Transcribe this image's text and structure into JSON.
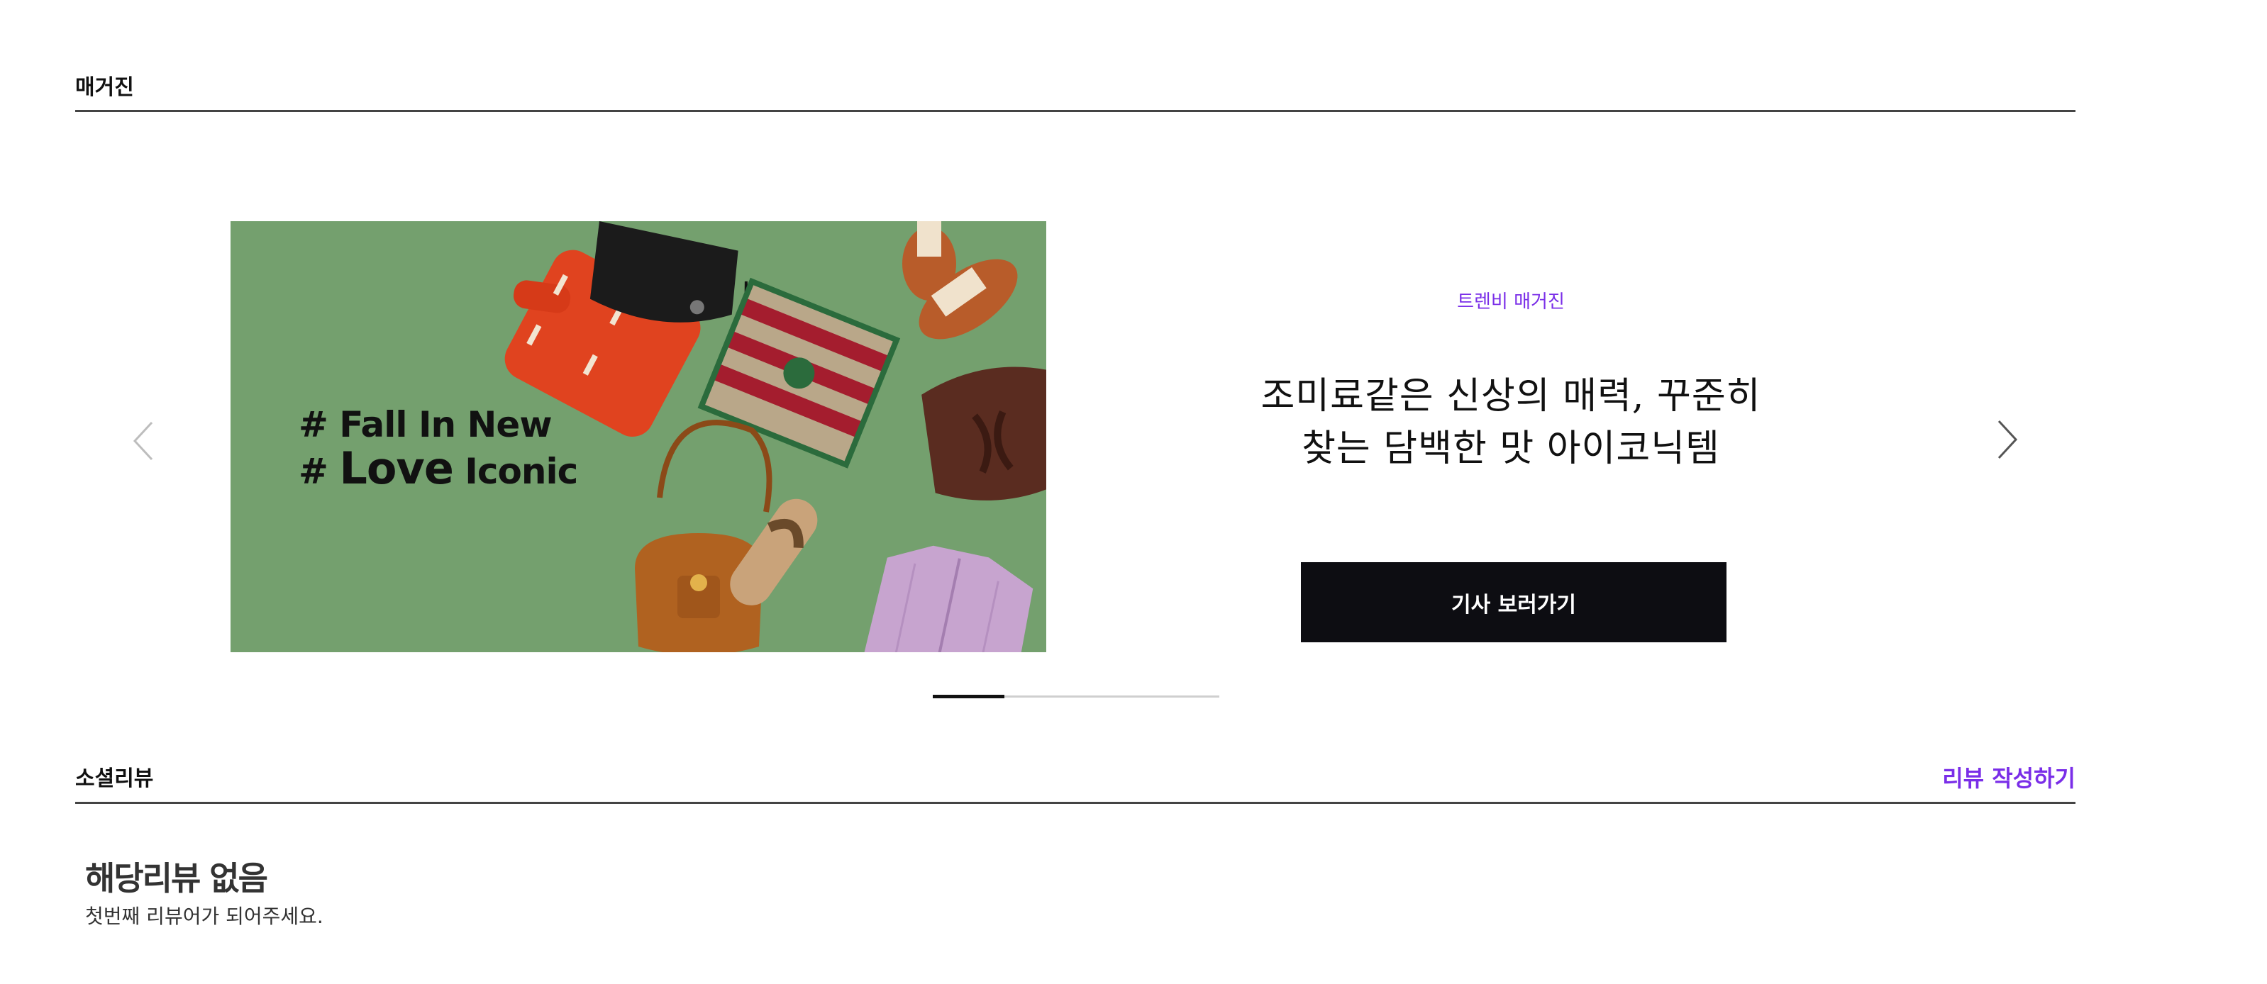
{
  "magazine": {
    "section_title": "매거진",
    "banner": {
      "line1": "# Fall In New",
      "line2_prefix": "# ",
      "line2_big": "Love",
      "line2_rest": " Iconic",
      "background_color": "#74a06e"
    },
    "article": {
      "tag": "트렌비 매거진",
      "title_line1": "조미료같은 신상의 매력, 꾸준히",
      "title_line2": "찾는 담백한 맛 아이코닉템",
      "button_label": "기사 보러가기"
    },
    "prev_icon": "chevron-left-icon",
    "next_icon": "chevron-right-icon",
    "slider_progress": 0.25,
    "accent_color": "#7a2ee8"
  },
  "reviews": {
    "section_title": "소셜리뷰",
    "write_label": "리뷰 작성하기",
    "empty_title": "해당리뷰 없음",
    "empty_subtitle": "첫번째 리뷰어가 되어주세요."
  }
}
